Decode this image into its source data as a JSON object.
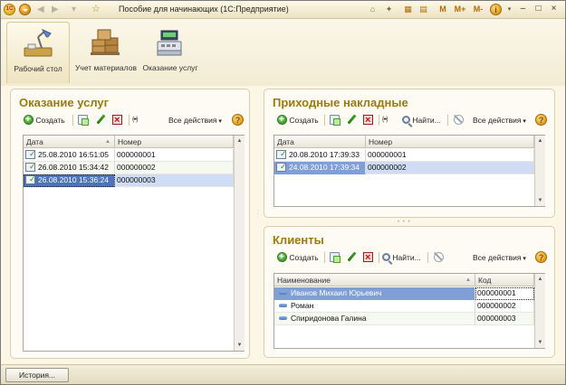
{
  "window": {
    "title": "Пособие для начинающих  (1С:Предприятие)",
    "logo_text": "1С",
    "tools": [
      "M",
      "M+",
      "M-"
    ]
  },
  "sections": [
    {
      "label": "Рабочий стол",
      "icon": "desktop-lamp-icon"
    },
    {
      "label": "Учет материалов",
      "icon": "boxes-icon"
    },
    {
      "label": "Оказание услуг",
      "icon": "cash-register-icon"
    }
  ],
  "services": {
    "title": "Оказание услуг",
    "toolbar": {
      "create": "Создать",
      "all_actions": "Все действия"
    },
    "columns": [
      "Дата",
      "Номер"
    ],
    "rows": [
      {
        "date": "25.08.2010 16:51:05",
        "number": "000000001"
      },
      {
        "date": "26.08.2010 15:34:42",
        "number": "000000002"
      },
      {
        "date": "26.08.2010 15:36:24",
        "number": "000000003"
      }
    ]
  },
  "invoices": {
    "title": "Приходные накладные",
    "toolbar": {
      "create": "Создать",
      "find": "Найти...",
      "all_actions": "Все действия"
    },
    "columns": [
      "Дата",
      "Номер"
    ],
    "rows": [
      {
        "date": "20.08.2010 17:39:33",
        "number": "000000001"
      },
      {
        "date": "24.08.2010 17:39:34",
        "number": "000000002"
      }
    ]
  },
  "clients": {
    "title": "Клиенты",
    "toolbar": {
      "create": "Создать",
      "find": "Найти...",
      "all_actions": "Все действия"
    },
    "columns": [
      "Наименование",
      "Код"
    ],
    "rows": [
      {
        "name": "Иванов Михаил Юрьевич",
        "code": "000000001"
      },
      {
        "name": "Роман",
        "code": "000000002"
      },
      {
        "name": "Спиридонова Галина",
        "code": "000000003"
      }
    ]
  },
  "footer": {
    "history": "История..."
  },
  "colors": {
    "accent_title": "#9c7a0c",
    "selection": "#4d73b8",
    "row_highlight": "#7f9fd6"
  }
}
